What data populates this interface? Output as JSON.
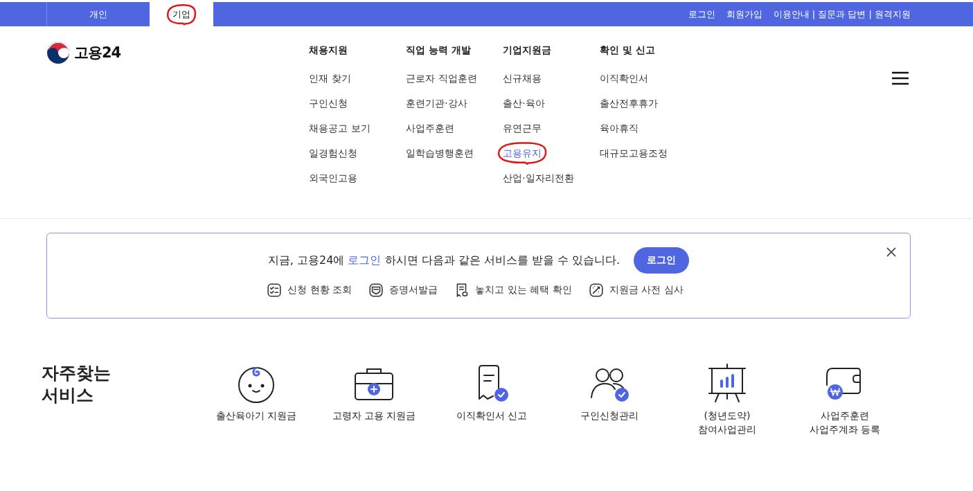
{
  "top_tabs": [
    {
      "label": "개인",
      "selected": false,
      "circled": false
    },
    {
      "label": "기업",
      "selected": true,
      "circled": true
    }
  ],
  "top_links": [
    "로그인",
    "회원가입",
    "이용안내 | 질문과 답변 | 원격지원"
  ],
  "logo": {
    "text": "고용24"
  },
  "nav": [
    {
      "title": "채용지원",
      "items": [
        {
          "label": "인재 찾기",
          "highlighted": false,
          "circled": false
        },
        {
          "label": "구인신청",
          "highlighted": false,
          "circled": false
        },
        {
          "label": "채용공고 보기",
          "highlighted": false,
          "circled": false
        },
        {
          "label": "일경험신청",
          "highlighted": false,
          "circled": false
        },
        {
          "label": "외국인고용",
          "highlighted": false,
          "circled": false
        }
      ]
    },
    {
      "title": "직업 능력 개발",
      "items": [
        {
          "label": "근로자 직업훈련",
          "highlighted": false,
          "circled": false
        },
        {
          "label": "훈련기관·강사",
          "highlighted": false,
          "circled": false
        },
        {
          "label": "사업주훈련",
          "highlighted": false,
          "circled": false
        },
        {
          "label": "일학습병행훈련",
          "highlighted": false,
          "circled": false
        }
      ]
    },
    {
      "title": "기업지원금",
      "items": [
        {
          "label": "신규채용",
          "highlighted": false,
          "circled": false
        },
        {
          "label": "출산·육아",
          "highlighted": false,
          "circled": false
        },
        {
          "label": "유연근무",
          "highlighted": false,
          "circled": false
        },
        {
          "label": "고용유지",
          "highlighted": true,
          "circled": true
        },
        {
          "label": "산업·일자리전환",
          "highlighted": false,
          "circled": false
        }
      ]
    },
    {
      "title": "확인 및 신고",
      "items": [
        {
          "label": "이직확인서",
          "highlighted": false,
          "circled": false
        },
        {
          "label": "출산전후휴가",
          "highlighted": false,
          "circled": false
        },
        {
          "label": "육아휴직",
          "highlighted": false,
          "circled": false
        },
        {
          "label": "대규모고용조정",
          "highlighted": false,
          "circled": false
        }
      ]
    }
  ],
  "login_banner": {
    "message": "지금, 고용24에 **로그인** 하시면 다음과 같은 서비스를 받을 수 있습니다.",
    "button": "로그인",
    "features": [
      {
        "kind": "checklist",
        "label": "신청 현황 조회"
      },
      {
        "kind": "certificate",
        "label": "증명서발급"
      },
      {
        "kind": "receipt",
        "label": "놓치고 있는 혜택 확인"
      },
      {
        "kind": "wand",
        "label": "지원금 사전 심사"
      }
    ]
  },
  "frequent_services": {
    "title": "자주찾는\n서비스",
    "items": [
      {
        "kind": "baby",
        "label": "출산육아기 지원금"
      },
      {
        "kind": "briefcase",
        "label": "고령자 고용 지원금"
      },
      {
        "kind": "document",
        "label": "이직확인서 신고"
      },
      {
        "kind": "people",
        "label": "구인신청관리"
      },
      {
        "kind": "board",
        "label": "(청년도약)\n참여사업관리"
      },
      {
        "kind": "wallet",
        "label": "사업주훈련\n사업주계좌 등록"
      }
    ]
  }
}
